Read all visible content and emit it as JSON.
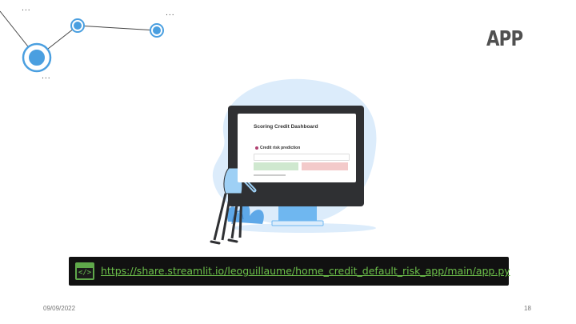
{
  "slide": {
    "title": "APP",
    "link_url": "https://share.streamlit.io/leoguillaume/home_credit_default_risk_app/main/app.py",
    "date": "09/09/2022",
    "page_number": "18"
  },
  "monitor_app": {
    "title": "Scoring Credit Dashboard",
    "section": "Credit risk prediction"
  },
  "decoration": {
    "ellipsis": "..."
  },
  "colors": {
    "title": "#505050",
    "node_blue": "#4a9fe0",
    "link_green": "#6cc04a",
    "link_bar_bg": "#111111"
  },
  "icons": {
    "code": "code-window-icon"
  }
}
